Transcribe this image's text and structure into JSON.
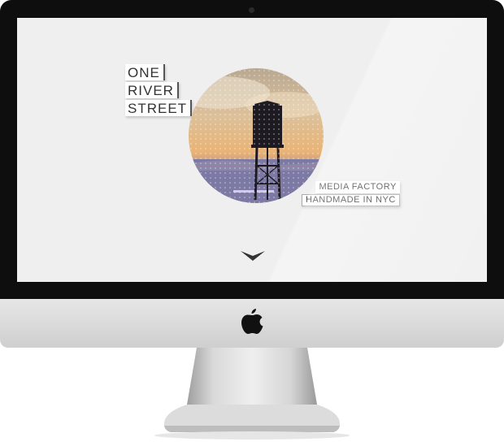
{
  "site": {
    "title_lines": [
      "ONE",
      "RIVER",
      "STREET"
    ],
    "tagline_1": "MEDIA FACTORY",
    "tagline_2": "HANDMADE IN NYC"
  },
  "colors": {
    "bezel": "#0e0e0e",
    "screen_bg": "#efefef",
    "text": "#333333",
    "sky_top": "#c9b59a",
    "sky_mid": "#e8b978",
    "water": "#7b79a8"
  },
  "icons": {
    "scroll": "chevron-down-icon",
    "brand": "apple-logo-icon"
  }
}
